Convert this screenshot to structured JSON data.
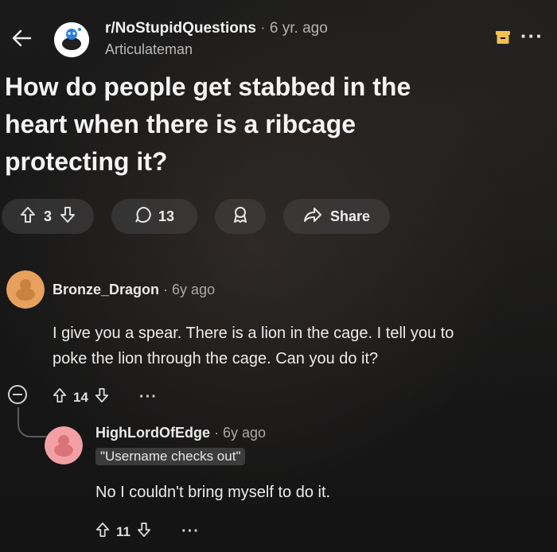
{
  "header": {
    "subreddit": "r/NoStupidQuestions",
    "separator": "·",
    "age": "6 yr. ago",
    "author": "Articulateman"
  },
  "post": {
    "title_line1": "How do people get stabbed in the",
    "title_line2": "heart when there is a ribcage",
    "title_line3": "protecting it?",
    "votes": "3",
    "comments": "13",
    "share_label": "Share"
  },
  "comments": [
    {
      "author": "Bronze_Dragon",
      "separator": "·",
      "age": "6y ago",
      "body_line1": "I give you a spear. There is a lion in the cage. I tell you to",
      "body_line2": "poke the lion through the cage. Can you do it?",
      "votes": "14",
      "more": "···"
    },
    {
      "author": "HighLordOfEdge",
      "separator": "·",
      "age": "6y ago",
      "flair": "\"Username checks out\"",
      "body": "No I couldn't bring myself to do it.",
      "votes": "11",
      "more": "···"
    }
  ],
  "colors": {
    "background": "#121212",
    "avatar1": "#e7a15c",
    "avatar2": "#f3a0a4"
  },
  "icons": [
    "back-arrow-icon",
    "subreddit-avatar",
    "save-icon",
    "more-icon",
    "upvote-icon",
    "downvote-icon",
    "comment-icon",
    "award-icon",
    "share-icon",
    "collapse-icon"
  ]
}
